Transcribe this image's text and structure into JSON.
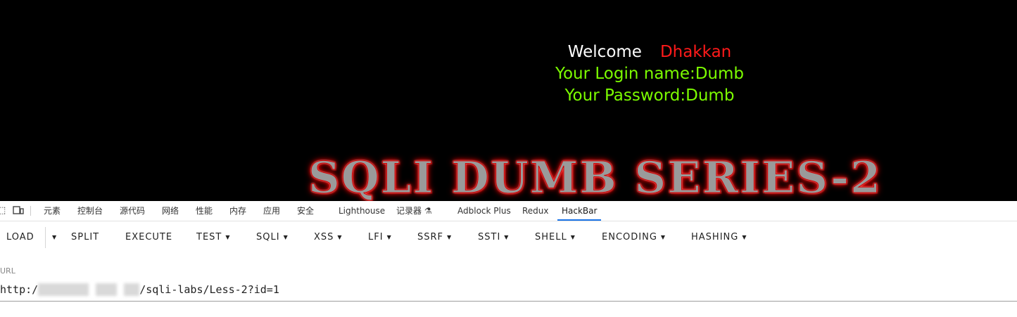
{
  "page": {
    "welcome_word": "Welcome",
    "welcome_name": "Dhakkan",
    "login_line": "Your Login name:Dumb",
    "password_line": "Your Password:Dumb",
    "banner": "SQLI DUMB SERIES-2"
  },
  "devtools": {
    "tabs": [
      "元素",
      "控制台",
      "源代码",
      "网络",
      "性能",
      "内存",
      "应用",
      "安全",
      "Lighthouse",
      "记录器",
      "Adblock Plus",
      "Redux",
      "HackBar"
    ],
    "active_tab": "HackBar"
  },
  "hackbar": {
    "buttons": {
      "load": "LOAD",
      "split": "SPLIT",
      "execute": "EXECUTE",
      "test": "TEST",
      "sqli": "SQLI",
      "xss": "XSS",
      "lfi": "LFI",
      "ssrf": "SSRF",
      "ssti": "SSTI",
      "shell": "SHELL",
      "encoding": "ENCODING",
      "hashing": "HASHING"
    },
    "url_label": "URL",
    "url_prefix": "http:/",
    "url_suffix": "/sqli-labs/Less-2?id=1"
  },
  "colors": {
    "page_bg": "#000000",
    "welcome": "#ffffff",
    "name": "#ff1a1a",
    "green_text": "#7cfc00",
    "active_tab_underline": "#1a73e8"
  }
}
